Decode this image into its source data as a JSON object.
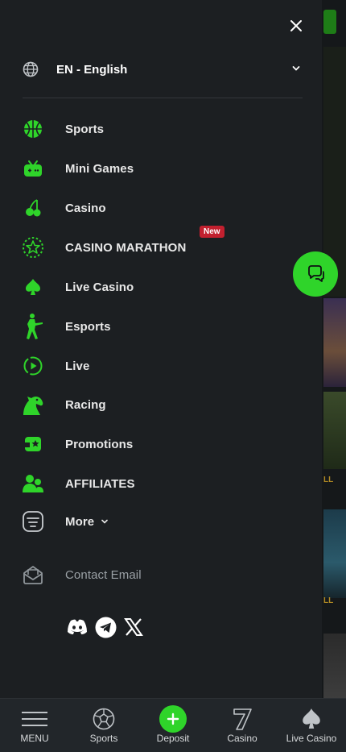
{
  "language": {
    "label": "EN - English"
  },
  "menu": {
    "items": [
      {
        "label": "Sports",
        "icon": "basketball-icon"
      },
      {
        "label": "Mini Games",
        "icon": "gamepad-icon"
      },
      {
        "label": "Casino",
        "icon": "cherry-icon"
      },
      {
        "label": "CASINO MARATHON",
        "icon": "star-badge-icon",
        "badge": "New"
      },
      {
        "label": "Live Casino",
        "icon": "spade-icon"
      },
      {
        "label": "Esports",
        "icon": "soldier-icon"
      },
      {
        "label": "Live",
        "icon": "play-circle-icon"
      },
      {
        "label": "Racing",
        "icon": "horse-icon"
      },
      {
        "label": "Promotions",
        "icon": "promo-icon"
      },
      {
        "label": "AFFILIATES",
        "icon": "users-icon"
      }
    ],
    "more_label": "More",
    "contact_label": "Contact Email"
  },
  "background_peek": {
    "label_1": "LL",
    "label_2": "LL"
  },
  "bottom_nav": {
    "items": [
      {
        "label": "MENU",
        "icon": "hamburger-icon"
      },
      {
        "label": "Sports",
        "icon": "soccer-ball-icon"
      },
      {
        "label": "Deposit",
        "icon": "plus-icon"
      },
      {
        "label": "Casino",
        "icon": "seven-icon"
      },
      {
        "label": "Live Casino",
        "icon": "spade-icon"
      }
    ]
  },
  "colors": {
    "accent": "#2fd42a",
    "drawer_bg": "#1c1f22",
    "badge": "#c2202f"
  }
}
